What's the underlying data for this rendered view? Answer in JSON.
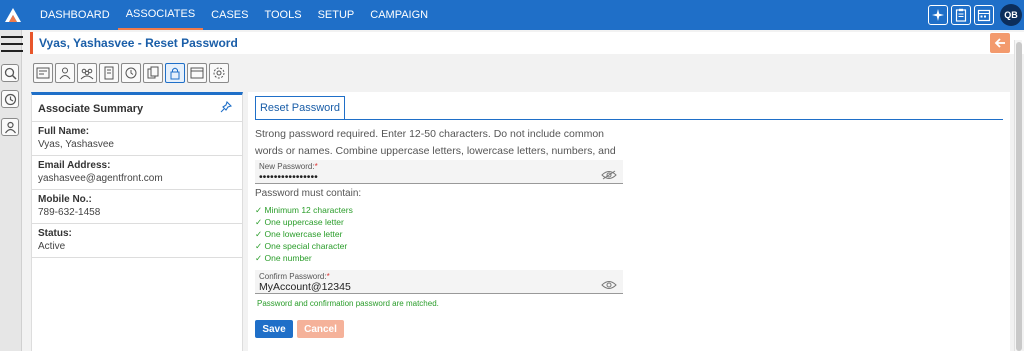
{
  "nav": {
    "items": [
      "DASHBOARD",
      "ASSOCIATES",
      "CASES",
      "TOOLS",
      "SETUP",
      "CAMPAIGN"
    ],
    "active": "ASSOCIATES"
  },
  "user": {
    "initials": "QB"
  },
  "page": {
    "title": "Vyas, Yashasvee - Reset Password"
  },
  "summary": {
    "title": "Associate Summary",
    "fields": [
      {
        "label": "Full Name:",
        "value": "Vyas, Yashasvee"
      },
      {
        "label": "Email Address:",
        "value": "yashasvee@agentfront.com"
      },
      {
        "label": "Mobile No.:",
        "value": "789-632-1458"
      },
      {
        "label": "Status:",
        "value": "Active"
      }
    ]
  },
  "reset": {
    "tab_label": "Reset Password",
    "instructions": "Strong password required. Enter 12-50 characters. Do not include common words or names. Combine uppercase letters, lowercase letters, numbers, and symbols.",
    "new_password": {
      "label": "New Password:",
      "required": "*",
      "value": "••••••••••••••••"
    },
    "must_contain": "Password must contain:",
    "rules": [
      "✓ Minimum 12 characters",
      "✓ One uppercase letter",
      "✓ One lowercase letter",
      "✓ One special character",
      "✓ One number"
    ],
    "confirm_password": {
      "label": "Confirm Password:",
      "required": "*",
      "value": "MyAccount@12345"
    },
    "match_message": "Password and confirmation password are matched.",
    "save_label": "Save",
    "cancel_label": "Cancel"
  },
  "colors": {
    "primary": "#1f6fc8",
    "accent": "#f07b4b",
    "success": "#2a9d2a",
    "cancel": "#f5b29a"
  }
}
